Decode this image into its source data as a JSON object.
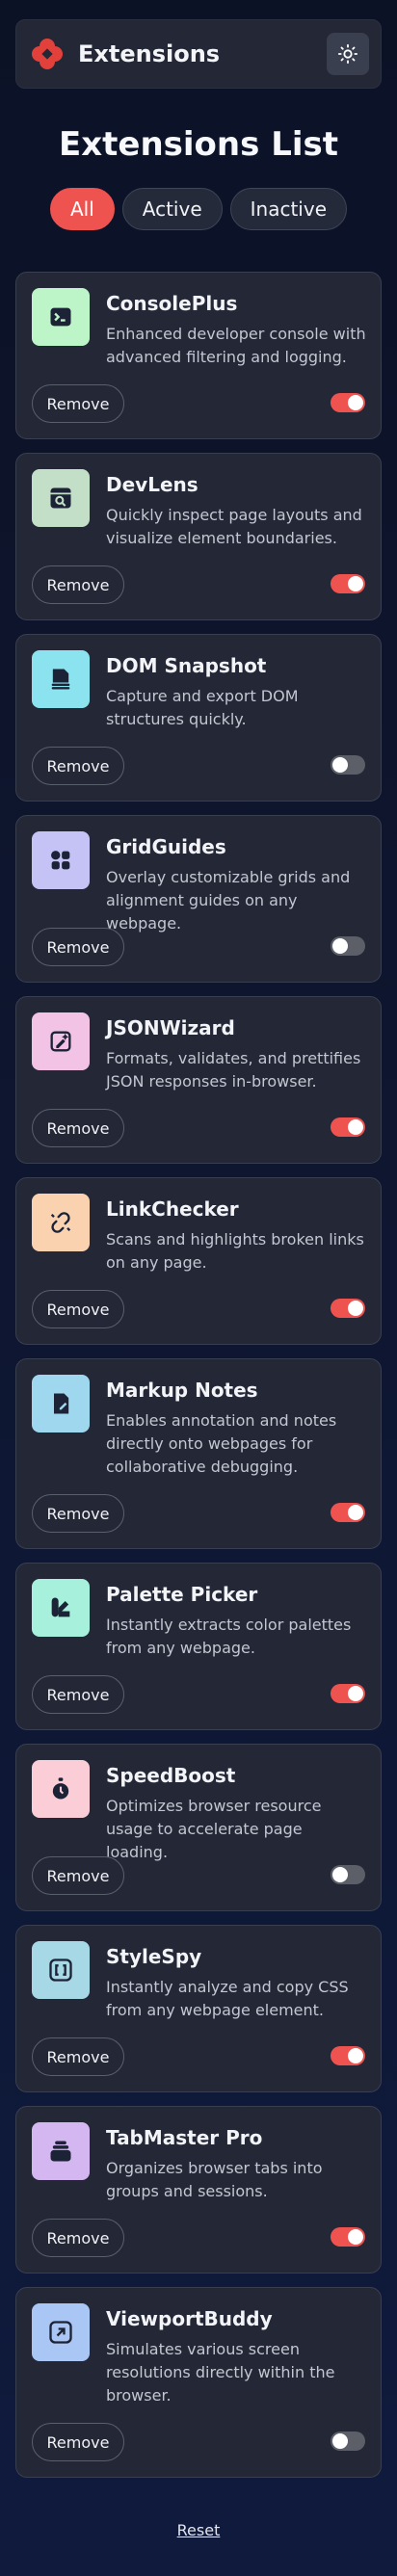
{
  "header": {
    "app_title": "Extensions",
    "logo_icon": "red-hexagon-logo-icon",
    "theme_icon": "sun-icon",
    "accent_color": "#ef5350"
  },
  "main": {
    "title": "Extensions List",
    "filters": [
      {
        "label": "All",
        "active": true
      },
      {
        "label": "Active",
        "active": false
      },
      {
        "label": "Inactive",
        "active": false
      }
    ]
  },
  "extensions": [
    {
      "name": "ConsolePlus",
      "description": "Enhanced developer console with advanced filtering and logging.",
      "enabled": true,
      "remove_label": "Remove",
      "icon": "terminal-icon",
      "icon_bg": "#bdf5c8"
    },
    {
      "name": "DevLens",
      "description": "Quickly inspect page layouts and visualize element boundaries.",
      "enabled": true,
      "remove_label": "Remove",
      "icon": "browser-search-icon",
      "icon_bg": "#c3dfc7"
    },
    {
      "name": "DOM Snapshot",
      "description": "Capture and export DOM structures quickly.",
      "enabled": false,
      "remove_label": "Remove",
      "icon": "document-stack-icon",
      "icon_bg": "#8ae3ee"
    },
    {
      "name": "GridGuides",
      "description": "Overlay customizable grids and alignment guides on any webpage.",
      "enabled": false,
      "remove_label": "Remove",
      "icon": "grid-shapes-icon",
      "icon_bg": "#c5c2f5"
    },
    {
      "name": "JSONWizard",
      "description": "Formats, validates, and prettifies JSON responses in-browser.",
      "enabled": true,
      "remove_label": "Remove",
      "icon": "magic-edit-icon",
      "icon_bg": "#f2c3e4"
    },
    {
      "name": "LinkChecker",
      "description": "Scans and highlights broken links on any page.",
      "enabled": true,
      "remove_label": "Remove",
      "icon": "broken-link-icon",
      "icon_bg": "#fbd2b0"
    },
    {
      "name": "Markup Notes",
      "description": "Enables annotation and notes directly onto webpages for collaborative debugging.",
      "enabled": true,
      "remove_label": "Remove",
      "icon": "note-pen-icon",
      "icon_bg": "#9fd7ee"
    },
    {
      "name": "Palette Picker",
      "description": "Instantly extracts color palettes from any webpage.",
      "enabled": true,
      "remove_label": "Remove",
      "icon": "palette-icon",
      "icon_bg": "#a6f0dc"
    },
    {
      "name": "SpeedBoost",
      "description": "Optimizes browser resource usage to accelerate page loading.",
      "enabled": false,
      "remove_label": "Remove",
      "icon": "stopwatch-icon",
      "icon_bg": "#fbcdd6"
    },
    {
      "name": "StyleSpy",
      "description": "Instantly analyze and copy CSS from any webpage element.",
      "enabled": true,
      "remove_label": "Remove",
      "icon": "code-brackets-icon",
      "icon_bg": "#a7d8e6"
    },
    {
      "name": "TabMaster Pro",
      "description": "Organizes browser tabs into groups and sessions.",
      "enabled": true,
      "remove_label": "Remove",
      "icon": "stacked-tabs-icon",
      "icon_bg": "#d4b6f0"
    },
    {
      "name": "ViewportBuddy",
      "description": "Simulates various screen resolutions directly within the browser.",
      "enabled": false,
      "remove_label": "Remove",
      "icon": "resize-arrow-icon",
      "icon_bg": "#a9c6f5"
    }
  ],
  "footer": {
    "reset_label": "Reset"
  }
}
